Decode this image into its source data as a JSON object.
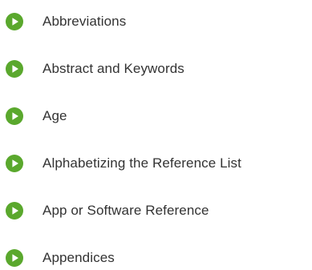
{
  "accent_color": "#5aa82d",
  "text_color": "#333333",
  "topics": [
    {
      "label": "Abbreviations",
      "icon": "play-circle-icon"
    },
    {
      "label": "Abstract and Keywords",
      "icon": "play-circle-icon"
    },
    {
      "label": "Age",
      "icon": "play-circle-icon"
    },
    {
      "label": "Alphabetizing the Reference List",
      "icon": "play-circle-icon"
    },
    {
      "label": "App or Software Reference",
      "icon": "play-circle-icon"
    },
    {
      "label": "Appendices",
      "icon": "play-circle-icon"
    }
  ]
}
